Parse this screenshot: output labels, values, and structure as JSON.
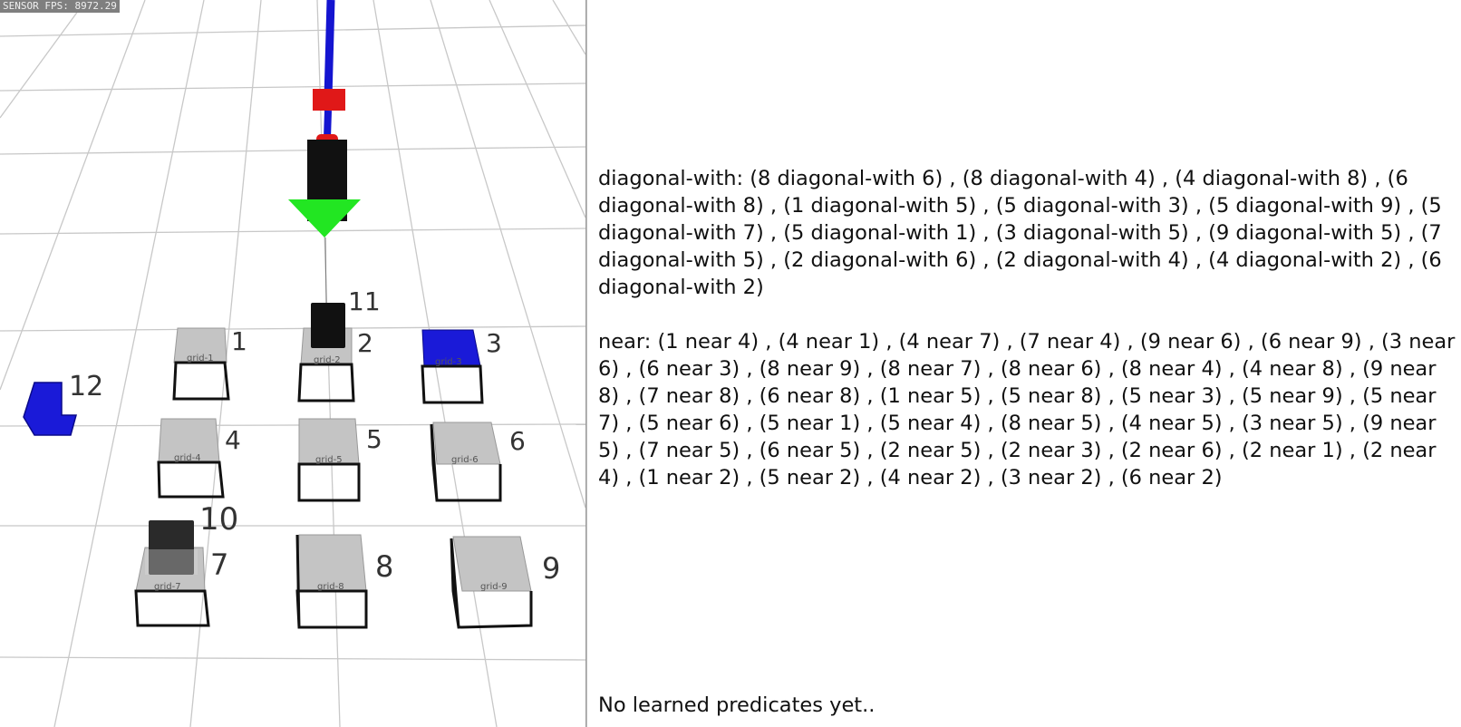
{
  "sensor_fps": "SENSOR FPS: 8972.29",
  "scene": {
    "cells": [
      {
        "label": "1",
        "grid": "grid-1"
      },
      {
        "label": "2",
        "grid": "grid-2"
      },
      {
        "label": "3",
        "grid": "grid-3"
      },
      {
        "label": "4",
        "grid": "grid-4"
      },
      {
        "label": "5",
        "grid": "grid-5"
      },
      {
        "label": "6",
        "grid": "grid-6"
      },
      {
        "label": "7",
        "grid": "grid-7"
      },
      {
        "label": "8",
        "grid": "grid-8"
      },
      {
        "label": "9",
        "grid": "grid-9"
      }
    ],
    "objects": [
      {
        "label": "10",
        "color": "#2a2a2a"
      },
      {
        "label": "11",
        "color": "#111111"
      },
      {
        "label": "12",
        "color": "#1a1ad8"
      }
    ],
    "highlight_color": "#1a1ad8",
    "gripper_color": "#111111",
    "arm_color": "#1414d0",
    "joint_color": "#e01818",
    "arrow_color": "#22e622"
  },
  "panel": {
    "diagonal_text": "diagonal-with: (8 diagonal-with 6) , (8 diagonal-with 4) , (4 diagonal-with 8) , (6 diagonal-with 8) , (1 diagonal-with 5) , (5 diagonal-with 3) , (5 diagonal-with 9) , (5 diagonal-with 7) , (5 diagonal-with 1) , (3 diagonal-with 5) , (9 diagonal-with 5) , (7 diagonal-with 5) , (2 diagonal-with 6) , (2 diagonal-with 4) , (4 diagonal-with 2) , (6 diagonal-with 2)",
    "near_text": "near: (1 near 4) , (4 near 1) , (4 near 7) , (7 near 4) , (9 near 6) , (6 near 9) , (3 near 6) , (6 near 3) , (8 near 9) , (8 near 7) , (8 near 6) , (8 near 4) , (4 near 8) , (9 near 8) , (7 near 8) , (6 near 8) , (1 near 5) , (5 near 8) , (5 near 3) , (5 near 9) , (5 near 7) , (5 near 6) , (5 near 1) , (5 near 4) , (8 near 5) , (4 near 5) , (3 near 5) , (9 near 5) , (7 near 5) , (6 near 5) , (2 near 5) , (2 near 3) , (2 near 6) , (2 near 1) , (2 near 4) , (1 near 2) , (5 near 2) , (4 near 2) , (3 near 2) , (6 near 2)",
    "learned_text": "No learned predicates yet.."
  }
}
